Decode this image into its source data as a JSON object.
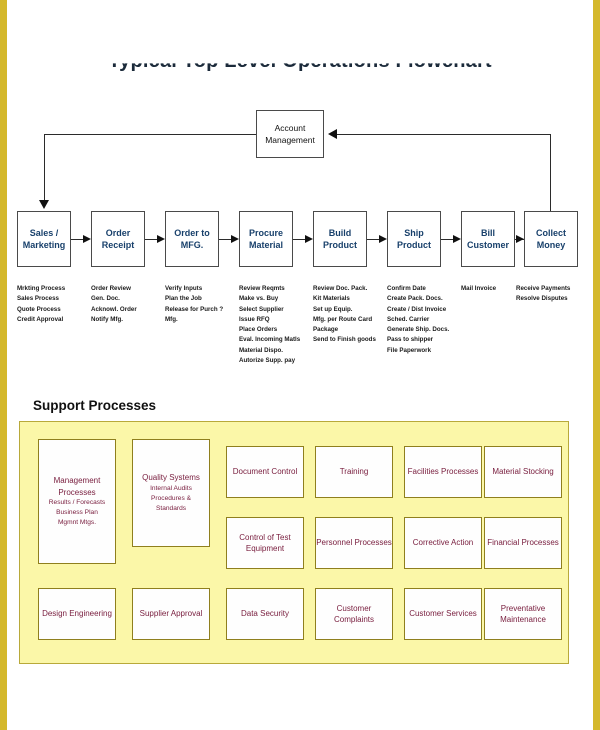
{
  "title": "Typical Top Level Operations Flowchart",
  "colors": {
    "page_border": "#d4b82c",
    "support_panel": "#fbf7a8",
    "support_panel_border": "#b8a93a",
    "process_text": "#18406b",
    "support_text": "#7a2040"
  },
  "hub": {
    "label_line1": "Account",
    "label_line2": "Management"
  },
  "process_flow": {
    "steps": [
      {
        "line1": "Sales /",
        "line2": "Marketing",
        "details": [
          "Mrkting Process",
          "Sales Process",
          "Quote Process",
          "Credit Approval"
        ]
      },
      {
        "line1": "Order",
        "line2": "Receipt",
        "details": [
          "Order Review",
          "Gen. Doc.",
          "Acknowl. Order",
          "Notify Mfg."
        ]
      },
      {
        "line1": "Order to",
        "line2": "MFG.",
        "details": [
          "Verify Inputs",
          "Plan the Job",
          "Release for Purch ?",
          "Mfg."
        ]
      },
      {
        "line1": "Procure",
        "line2": "Material",
        "details": [
          "Review Reqmts",
          "Make vs. Buy",
          "Select Supplier",
          "Issue RFQ",
          "Place Orders",
          "Eval. Incoming Matls",
          "Material Dispo.",
          "Autorize Supp. pay"
        ]
      },
      {
        "line1": "Build",
        "line2": "Product",
        "details": [
          "Review Doc. Pack.",
          "Kit Materials",
          "Set up Equip.",
          "Mfg. per Route Card",
          "Package",
          "Send to Finish goods"
        ]
      },
      {
        "line1": "Ship",
        "line2": "Product",
        "details": [
          "Confirm Date",
          "Create Pack. Docs.",
          "Create / Dist Invoice",
          "Sched. Carrier",
          "Generate Ship. Docs.",
          "Pass to shipper",
          "File Paperwork"
        ]
      },
      {
        "line1": "Bill",
        "line2": "Customer",
        "details": [
          "Mail Invoice"
        ]
      },
      {
        "line1": "Collect",
        "line2": "Money",
        "details": [
          "Receive Payments",
          "Resolve Disputes"
        ]
      }
    ]
  },
  "support": {
    "heading": "Support Processes",
    "boxes": [
      {
        "title": "Management Processes",
        "subs": [
          "Results / Forecasts",
          "Business Plan",
          "Mgmnt Mtgs."
        ]
      },
      {
        "title": "Quality Systems",
        "subs": [
          "Internal Audits",
          "Procedures &",
          "Standards"
        ]
      },
      {
        "title": "Document Control",
        "subs": []
      },
      {
        "title": "Training",
        "subs": []
      },
      {
        "title": "Facilities Processes",
        "subs": []
      },
      {
        "title": "Material Stocking",
        "subs": []
      },
      {
        "title": "Control of Test Equipment",
        "subs": []
      },
      {
        "title": "Personnel Processes",
        "subs": []
      },
      {
        "title": "Corrective Action",
        "subs": []
      },
      {
        "title": "Financial Processes",
        "subs": []
      },
      {
        "title": "Design Engineering",
        "subs": []
      },
      {
        "title": "Supplier Approval",
        "subs": []
      },
      {
        "title": "Data Security",
        "subs": []
      },
      {
        "title": "Customer Complaints",
        "subs": []
      },
      {
        "title": "Customer Services",
        "subs": []
      },
      {
        "title": "Preventative Maintenance",
        "subs": []
      }
    ]
  },
  "watermark": ""
}
